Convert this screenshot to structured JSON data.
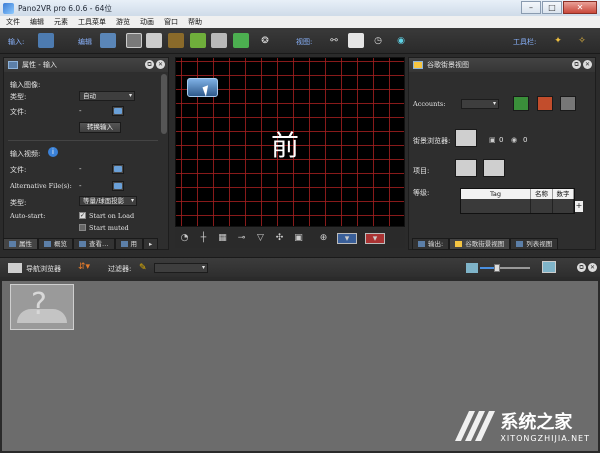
{
  "window": {
    "title": "Pano2VR pro 6.0.6 - 64位"
  },
  "menu": [
    "文件",
    "编辑",
    "元素",
    "工具菜单",
    "游览",
    "动画",
    "窗口",
    "帮助"
  ],
  "toolbar": {
    "input_label": "输入:",
    "edit_label": "编辑",
    "view_label": "视图:",
    "tools_label": "工具栏:"
  },
  "properties": {
    "title": "属性 - 输入",
    "input_image_label": "输入图像:",
    "type_label": "类型:",
    "type_value": "自动",
    "file_label": "文件:",
    "file_value": "-",
    "convert_button": "转换输入",
    "input_video_label": "输入视频:",
    "video_file_label": "文件:",
    "video_file_value": "-",
    "alt_files_label": "Alternative File(s):",
    "alt_files_value": "-",
    "video_type_label": "类型:",
    "video_type_value": "等量/球面投影",
    "autostart_label": "Auto-start:",
    "start_on_load": "Start on Load",
    "start_muted": "Start muted"
  },
  "left_tabs": [
    "属性",
    "概览",
    "查看…",
    "用"
  ],
  "viewer": {
    "overlay_char": "前"
  },
  "google": {
    "title": "谷歌街景视图",
    "accounts_label": "Accounts:",
    "browser_label": "街景浏览器:",
    "count_photos": "0",
    "count_views": "0",
    "items_label": "项目:",
    "level_label": "等级:",
    "table_headers": [
      "Tag",
      "名称",
      "数字"
    ]
  },
  "right_tabs": [
    "输出:",
    "谷歌街景视图",
    "列表视图"
  ],
  "navigator": {
    "title": "导航浏览器",
    "filter_label": "过滤器:"
  },
  "watermark": {
    "brand": "系统之家",
    "url": "XITONGZHIJIA.NET"
  }
}
